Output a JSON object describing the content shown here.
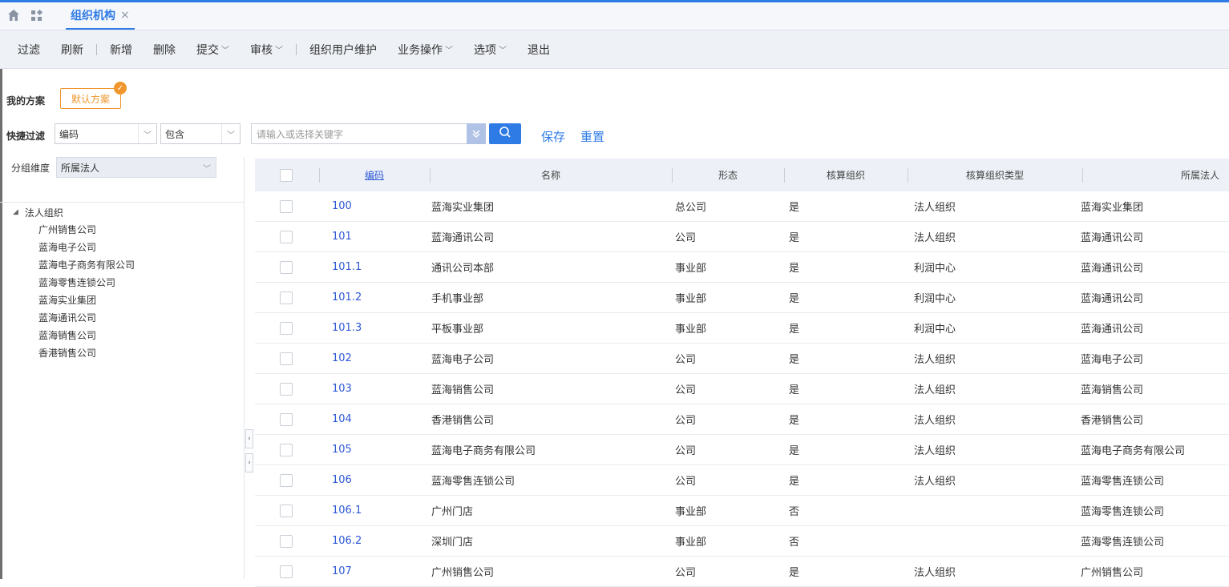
{
  "tabbar": {
    "tab_label": "组织机构",
    "close_glyph": "×",
    "icons": [
      "home-icon",
      "apps-icon"
    ]
  },
  "toolbar": {
    "filter": "过滤",
    "refresh": "刷新",
    "add": "新增",
    "delete": "删除",
    "submit": "提交",
    "audit": "审核",
    "org_user": "组织用户维护",
    "business": "业务操作",
    "options": "选项",
    "exit": "退出"
  },
  "scheme": {
    "label": "我的方案",
    "default": "默认方案"
  },
  "quick_filter": {
    "label": "快捷过滤",
    "field": "编码",
    "operator": "包含",
    "placeholder": "请输入或选择关键字",
    "save": "保存",
    "reset": "重置"
  },
  "group_dim": {
    "label": "分组维度",
    "value": "所属法人"
  },
  "tree": {
    "root": "法人组织",
    "children": [
      "广州销售公司",
      "蓝海电子公司",
      "蓝海电子商务有限公司",
      "蓝海零售连锁公司",
      "蓝海实业集团",
      "蓝海通讯公司",
      "蓝海销售公司",
      "香港销售公司"
    ]
  },
  "grid": {
    "columns": [
      "编码",
      "名称",
      "形态",
      "核算组织",
      "核算组织类型",
      "所属法人"
    ],
    "rows": [
      [
        "100",
        "蓝海实业集团",
        "总公司",
        "是",
        "法人组织",
        "蓝海实业集团"
      ],
      [
        "101",
        "蓝海通讯公司",
        "公司",
        "是",
        "法人组织",
        "蓝海通讯公司"
      ],
      [
        "101.1",
        "通讯公司本部",
        "事业部",
        "是",
        "利润中心",
        "蓝海通讯公司"
      ],
      [
        "101.2",
        "手机事业部",
        "事业部",
        "是",
        "利润中心",
        "蓝海通讯公司"
      ],
      [
        "101.3",
        "平板事业部",
        "事业部",
        "是",
        "利润中心",
        "蓝海通讯公司"
      ],
      [
        "102",
        "蓝海电子公司",
        "公司",
        "是",
        "法人组织",
        "蓝海电子公司"
      ],
      [
        "103",
        "蓝海销售公司",
        "公司",
        "是",
        "法人组织",
        "蓝海销售公司"
      ],
      [
        "104",
        "香港销售公司",
        "公司",
        "是",
        "法人组织",
        "香港销售公司"
      ],
      [
        "105",
        "蓝海电子商务有限公司",
        "公司",
        "是",
        "法人组织",
        "蓝海电子商务有限公司"
      ],
      [
        "106",
        "蓝海零售连锁公司",
        "公司",
        "是",
        "法人组织",
        "蓝海零售连锁公司"
      ],
      [
        "106.1",
        "广州门店",
        "事业部",
        "否",
        "",
        "蓝海零售连锁公司"
      ],
      [
        "106.2",
        "深圳门店",
        "事业部",
        "否",
        "",
        "蓝海零售连锁公司"
      ],
      [
        "107",
        "广州销售公司",
        "公司",
        "是",
        "法人组织",
        "广州销售公司"
      ]
    ]
  }
}
